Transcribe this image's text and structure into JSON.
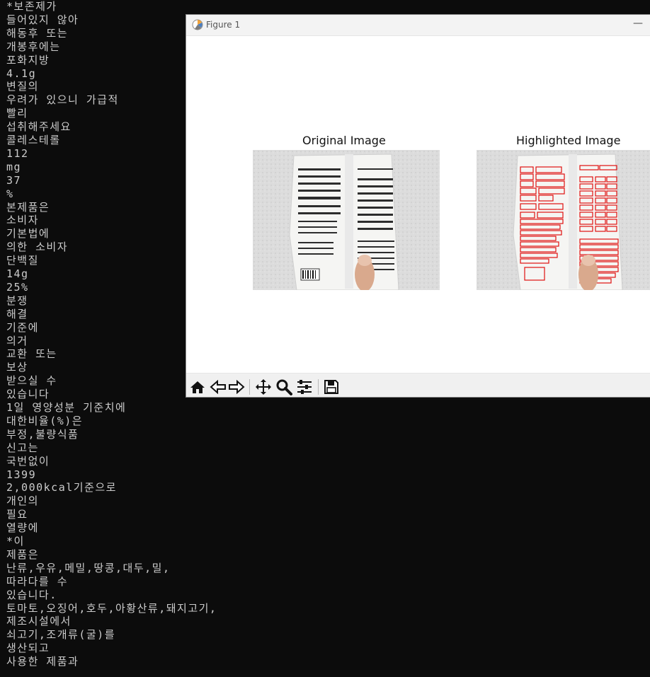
{
  "terminal": {
    "lines": [
      "*보존제가",
      "들어있지 않아",
      "해동후 또는",
      "개봉후에는",
      "포화지방",
      "4.1g",
      "변질의",
      "우려가 있으니 가급적",
      "빨리",
      "섭취해주세요",
      "콜레스테롤",
      "112",
      "mg",
      "37",
      "%",
      "본제품은",
      "소비자",
      "기본법에",
      "의한 소비자",
      "단백질",
      "14g",
      "25%",
      "분쟁",
      "해결",
      "기준에",
      "의거",
      "교환 또는",
      "보상",
      "받으실 수",
      "있습니다",
      "1일 영양성분 기준치에",
      "대한비율(%)은",
      "부정,불량식품",
      "신고는",
      "국번없이",
      "1399",
      "2,000kcal기준으로",
      "개인의",
      "필요",
      "열량에",
      "*이",
      "제품은",
      "난류,우유,메밀,땅콩,대두,밀,",
      "따라다를 수",
      "있습니다.",
      "토마토,오징어,호두,아황산류,돼지고기,",
      "제조시설에서",
      "쇠고기,조개류(굴)를",
      "생산되고",
      "사용한 제품과"
    ]
  },
  "figure": {
    "window_title": "Figure 1",
    "minimize_label": "—",
    "axes": [
      {
        "title": "Original Image"
      },
      {
        "title": "Highlighted Image"
      }
    ],
    "toolbar": {
      "tools": [
        "home-icon",
        "back-icon",
        "forward-icon",
        "pan-icon",
        "zoom-icon",
        "configure-subplots-icon",
        "save-icon"
      ]
    }
  },
  "colors": {
    "terminal_bg": "#0c0c0c",
    "terminal_fg": "#cccccc",
    "highlight_box": "#e01010"
  }
}
